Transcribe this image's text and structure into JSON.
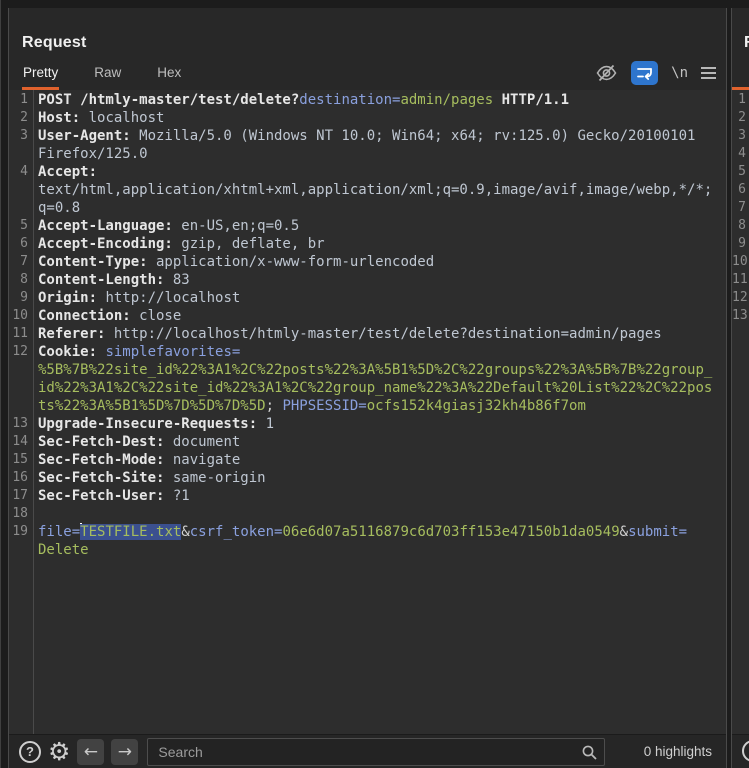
{
  "request_panel": {
    "title": "Request",
    "tabs": [
      {
        "label": "Pretty",
        "selected": true
      },
      {
        "label": "Raw",
        "selected": false
      },
      {
        "label": "Hex",
        "selected": false
      }
    ],
    "toolbar": {
      "hide_icon": "eye-slash",
      "wrap_icon": "word-wrap",
      "wrap_active": true,
      "newline_label": "\\n",
      "menu_icon": "hamburger-menu"
    },
    "editor": {
      "lines": [
        {
          "num": 1,
          "segments": [
            {
              "t": "POST /htmly-master/test/delete?",
              "c": "b"
            },
            {
              "t": "destination=",
              "c": "pn"
            },
            {
              "t": "admin/pages",
              "c": "pv"
            },
            {
              "t": " HTTP/1.1",
              "c": "b"
            }
          ]
        },
        {
          "num": 2,
          "segments": [
            {
              "t": "Host:",
              "c": "b"
            },
            {
              "t": " localhost",
              "c": "v"
            }
          ]
        },
        {
          "num": 3,
          "segments": [
            {
              "t": "User-Agent:",
              "c": "b"
            },
            {
              "t": " Mozilla/5.0 (Windows NT 10.0; Win64; x64; rv:125.0) Gecko/20100101 Firefox/125.0",
              "c": "v"
            }
          ]
        },
        {
          "num": 4,
          "segments": [
            {
              "t": "Accept:",
              "c": "b"
            },
            {
              "t": " text/html,application/xhtml+xml,application/xml;q=0.9,image/avif,image/webp,*/*;q=0.8",
              "c": "v"
            }
          ]
        },
        {
          "num": 5,
          "segments": [
            {
              "t": "Accept-Language:",
              "c": "b"
            },
            {
              "t": " en-US,en;q=0.5",
              "c": "v"
            }
          ]
        },
        {
          "num": 6,
          "segments": [
            {
              "t": "Accept-Encoding:",
              "c": "b"
            },
            {
              "t": " gzip, deflate, br",
              "c": "v"
            }
          ]
        },
        {
          "num": 7,
          "segments": [
            {
              "t": "Content-Type:",
              "c": "b"
            },
            {
              "t": " application/x-www-form-urlencoded",
              "c": "v"
            }
          ]
        },
        {
          "num": 8,
          "segments": [
            {
              "t": "Content-Length:",
              "c": "b"
            },
            {
              "t": " 83",
              "c": "v"
            }
          ]
        },
        {
          "num": 9,
          "segments": [
            {
              "t": "Origin:",
              "c": "b"
            },
            {
              "t": " http://localhost",
              "c": "v"
            }
          ]
        },
        {
          "num": 10,
          "segments": [
            {
              "t": "Connection:",
              "c": "b"
            },
            {
              "t": " close",
              "c": "v"
            }
          ]
        },
        {
          "num": 11,
          "segments": [
            {
              "t": "Referer:",
              "c": "b"
            },
            {
              "t": " http://localhost/htmly-master/test/delete?destination=admin/pages",
              "c": "v"
            }
          ]
        },
        {
          "num": 12,
          "segments": [
            {
              "t": "Cookie:",
              "c": "b"
            },
            {
              "t": " ",
              "c": "v"
            },
            {
              "t": "simplefavorites=",
              "c": "pn"
            },
            {
              "t": "%5B%7B%22site_id%22%3A1%2C%22posts%22%3A%5B1%5D%2C%22groups%22%3A%5B%7B%22group_id%22%3A1%2C%22site_id%22%3A1%2C%22group_name%22%3A%22Default%20List%22%2C%22posts%22%3A%5B1%5D%7D%5D%7D%5D",
              "c": "pv"
            },
            {
              "t": "; ",
              "c": "sep"
            },
            {
              "t": "PHPSESSID=",
              "c": "pn"
            },
            {
              "t": "ocfs152k4giasj32kh4b86f7om",
              "c": "pv"
            }
          ]
        },
        {
          "num": 13,
          "segments": [
            {
              "t": "Upgrade-Insecure-Requests:",
              "c": "b"
            },
            {
              "t": " 1",
              "c": "v"
            }
          ]
        },
        {
          "num": 14,
          "segments": [
            {
              "t": "Sec-Fetch-Dest:",
              "c": "b"
            },
            {
              "t": " document",
              "c": "v"
            }
          ]
        },
        {
          "num": 15,
          "segments": [
            {
              "t": "Sec-Fetch-Mode:",
              "c": "b"
            },
            {
              "t": " navigate",
              "c": "v"
            }
          ]
        },
        {
          "num": 16,
          "segments": [
            {
              "t": "Sec-Fetch-Site:",
              "c": "b"
            },
            {
              "t": " same-origin",
              "c": "v"
            }
          ]
        },
        {
          "num": 17,
          "segments": [
            {
              "t": "Sec-Fetch-User:",
              "c": "b"
            },
            {
              "t": " ?1",
              "c": "v"
            }
          ]
        },
        {
          "num": 18,
          "segments": []
        },
        {
          "num": 19,
          "segments": [
            {
              "t": "file=",
              "c": "pn"
            },
            {
              "t": "TESTFILE.txt",
              "c": "pv sel",
              "caret": true
            },
            {
              "t": "&",
              "c": "sep"
            },
            {
              "t": "csrf_token=",
              "c": "pn"
            },
            {
              "t": "06e6d07a5116879c6d703ff153e47150b1da0549",
              "c": "pv"
            },
            {
              "t": "&",
              "c": "sep"
            },
            {
              "t": "submit=",
              "c": "pn"
            },
            {
              "t": "Delete",
              "c": "pv"
            }
          ]
        }
      ]
    },
    "footer": {
      "help_label": "?",
      "settings_icon_glyph": "⚙",
      "back_arrow": "←",
      "forward_arrow": "→",
      "search_placeholder": "Search",
      "search_value": "",
      "highlights_label": "0 highlights"
    }
  },
  "response_panel_sliver": {
    "title_partial": "R",
    "line_numbers": [
      1,
      2,
      3,
      4,
      5,
      6,
      7,
      8,
      9,
      10,
      11,
      12,
      13
    ]
  },
  "colors": {
    "accent_orange": "#e0622d",
    "wrap_button_blue": "#2e75cd",
    "selection_blue": "#3b508f",
    "param_name_blue": "#8aa0de",
    "param_value_olive": "#a6bd5e",
    "header_name_white": "#e6e6e6",
    "header_value_gray": "#bfc7d2",
    "editor_background": "#2d2d2d"
  }
}
